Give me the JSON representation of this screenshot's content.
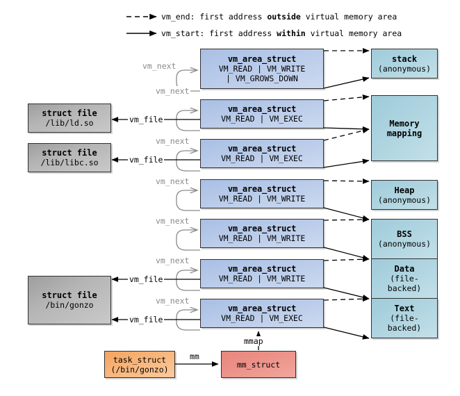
{
  "legend": [
    {
      "arrow": "dashed",
      "prefix": "vm_end: first address ",
      "emph": "outside",
      "suffix": " virtual memory area"
    },
    {
      "arrow": "solid",
      "prefix": "vm_start: first address ",
      "emph": "within",
      "suffix": " virtual memory area"
    }
  ],
  "vm_areas": [
    {
      "title": "vm_area_struct",
      "flags1": "VM_READ | VM_WRITE",
      "flags2": "| VM_GROWS_DOWN"
    },
    {
      "title": "vm_area_struct",
      "flags1": "VM_READ | VM_EXEC",
      "flags2": ""
    },
    {
      "title": "vm_area_struct",
      "flags1": "VM_READ | VM_EXEC",
      "flags2": ""
    },
    {
      "title": "vm_area_struct",
      "flags1": "VM_READ | VM_WRITE",
      "flags2": ""
    },
    {
      "title": "vm_area_struct",
      "flags1": "VM_READ | VM_WRITE",
      "flags2": ""
    },
    {
      "title": "vm_area_struct",
      "flags1": "VM_READ | VM_WRITE",
      "flags2": ""
    },
    {
      "title": "vm_area_struct",
      "flags1": "VM_READ | VM_EXEC",
      "flags2": ""
    }
  ],
  "struct_files": [
    {
      "title": "struct file",
      "path": "/lib/ld.so"
    },
    {
      "title": "struct file",
      "path": "/lib/libc.so"
    },
    {
      "title": "struct file",
      "path": "/bin/gonzo"
    }
  ],
  "memory_regions": [
    {
      "line1": "stack",
      "line2": "(anonymous)",
      "line3": ""
    },
    {
      "line1": "Memory",
      "line2": "mapping",
      "line3": ""
    },
    {
      "line1": "Heap",
      "line2": "(anonymous)",
      "line3": ""
    },
    {
      "line1": "BSS",
      "line2": "(anonymous)",
      "line3": ""
    },
    {
      "line1": "Data",
      "line2": "(file-",
      "line3": "backed)"
    },
    {
      "line1": "Text",
      "line2": "(file-",
      "line3": "backed)"
    }
  ],
  "process": {
    "task_struct_line1": "task_struct",
    "task_struct_line2": "(/bin/gonzo)",
    "mm_struct": "mm_struct",
    "mm_label": "mm",
    "mmap_label": "mmap"
  },
  "edge_labels": {
    "vm_next": "vm_next",
    "vm_file": "vm_file"
  },
  "colors": {
    "vma": "#b9cbe9",
    "struct_file": "#b5b5b5",
    "memory_region": "#aed4e0",
    "task_struct": "#f8b57a",
    "mm_struct": "#ec9289",
    "stroke": "#2f2f2f",
    "gray_label": "#8a8a8a"
  }
}
